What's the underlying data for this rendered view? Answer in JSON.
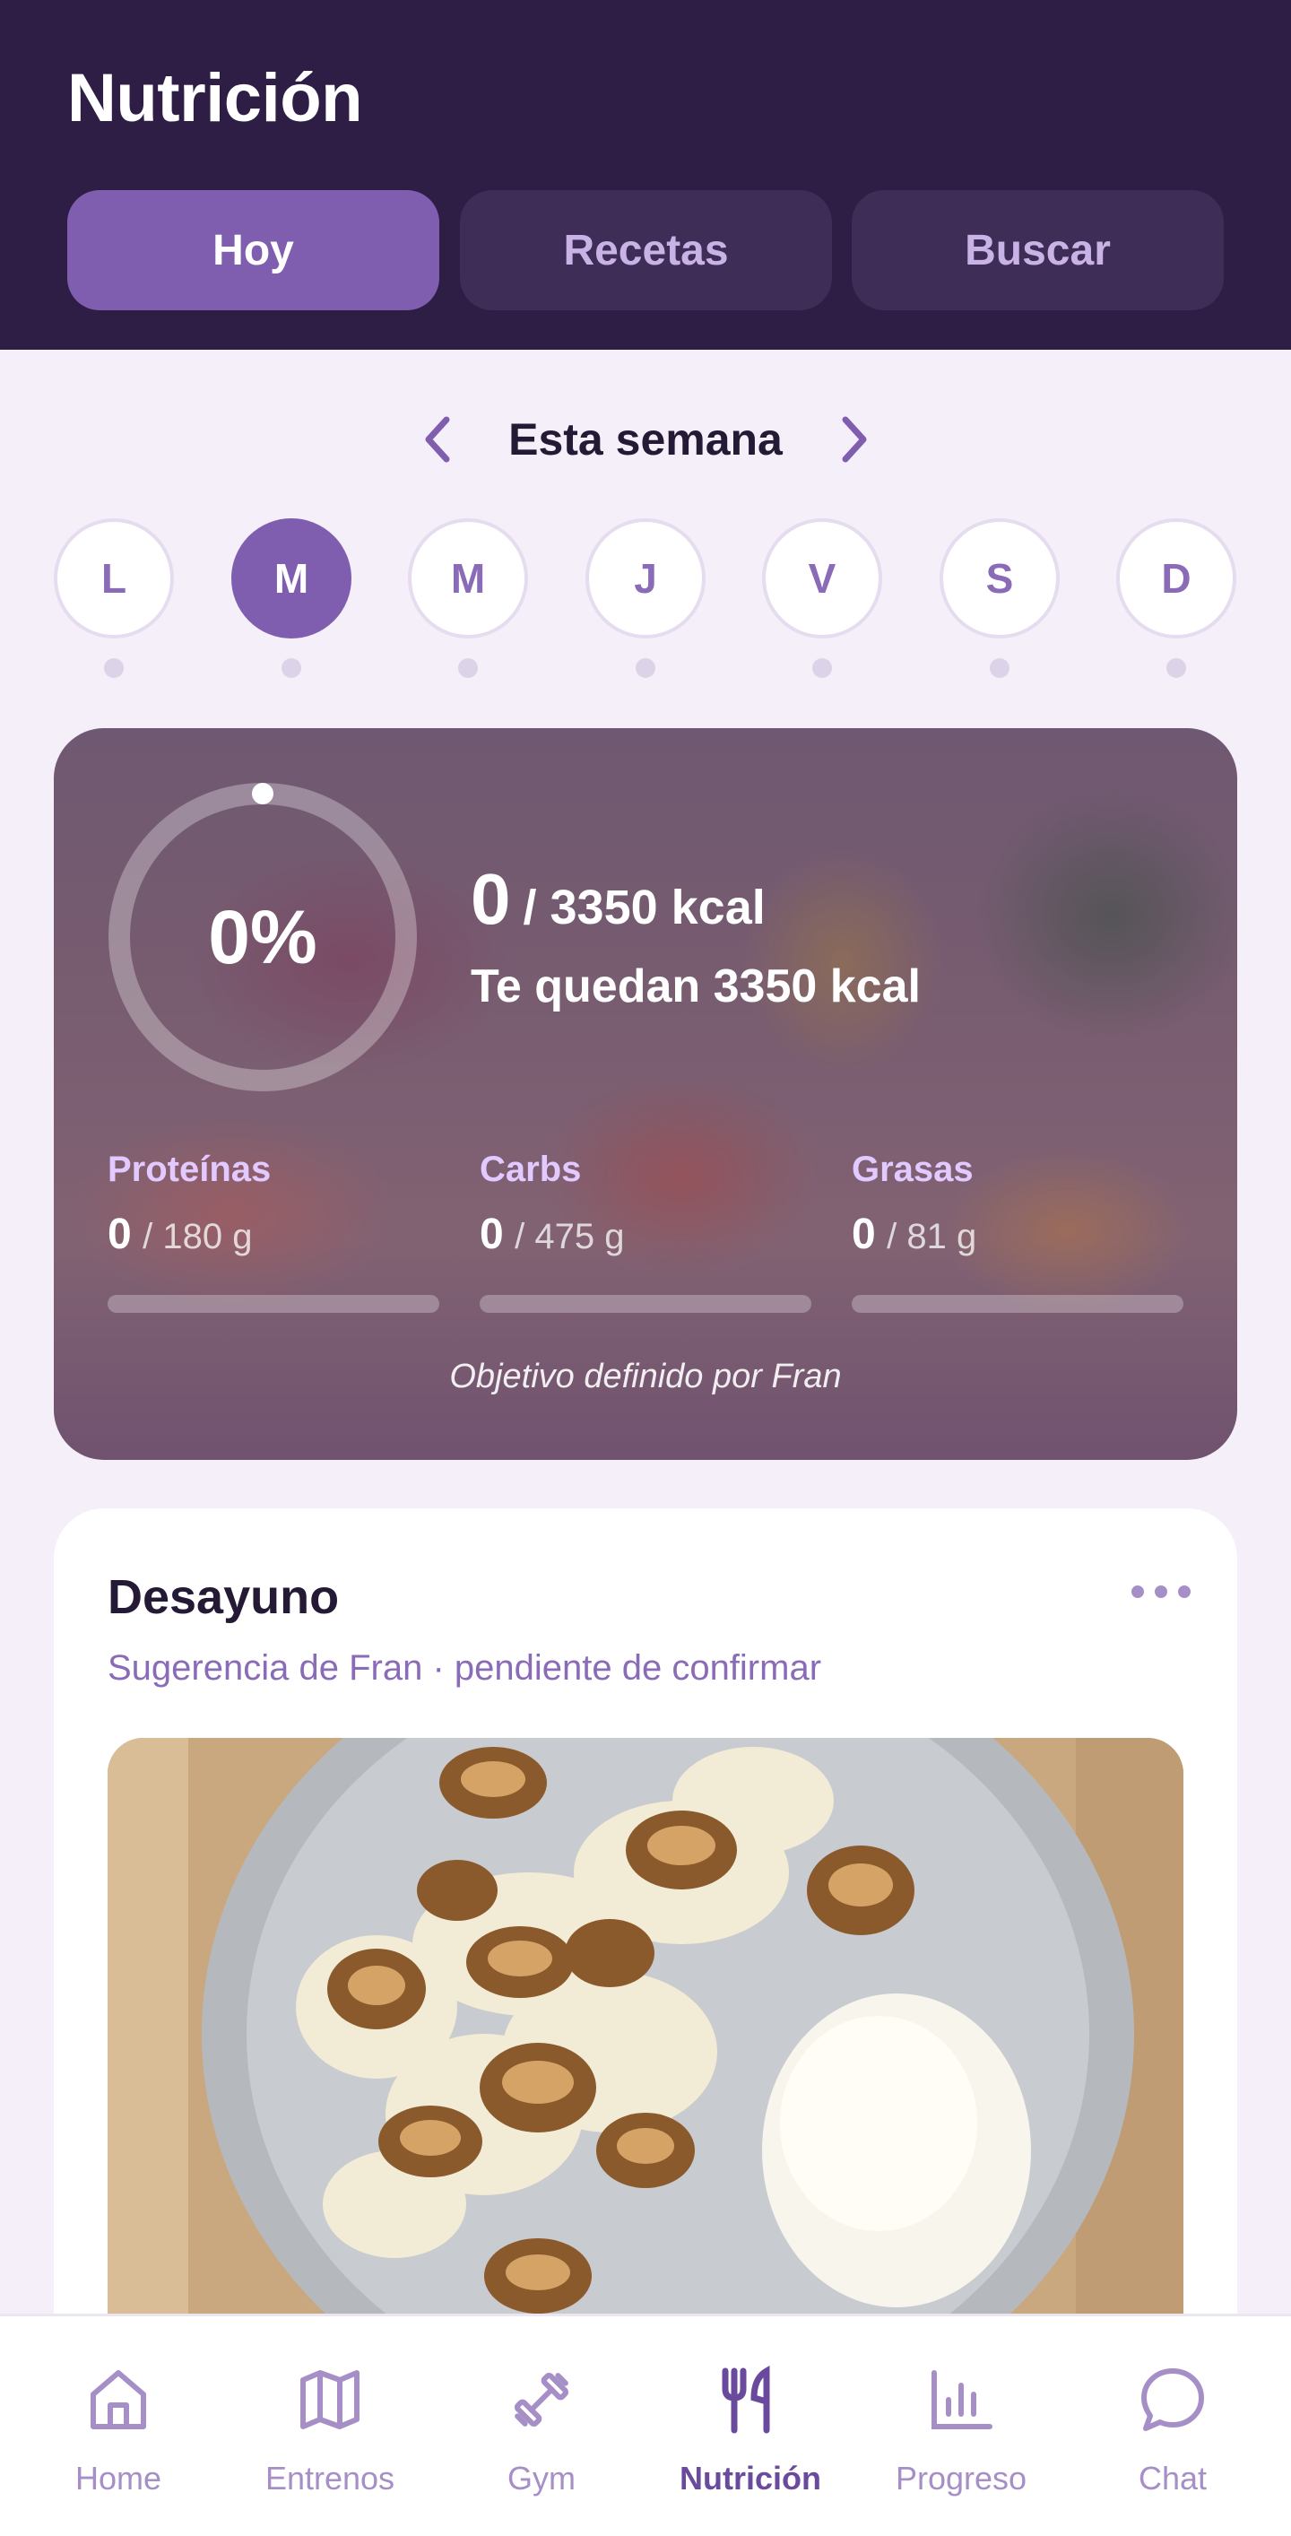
{
  "header": {
    "title": "Nutrición",
    "tabs": [
      {
        "label": "Hoy",
        "active": true
      },
      {
        "label": "Recetas",
        "active": false
      },
      {
        "label": "Buscar",
        "active": false
      }
    ]
  },
  "week": {
    "label": "Esta semana",
    "days": [
      {
        "letter": "L",
        "active": false
      },
      {
        "letter": "M",
        "active": true
      },
      {
        "letter": "M",
        "active": false
      },
      {
        "letter": "J",
        "active": false
      },
      {
        "letter": "V",
        "active": false
      },
      {
        "letter": "S",
        "active": false
      },
      {
        "letter": "D",
        "active": false
      }
    ]
  },
  "summary": {
    "percent_label": "0%",
    "progress_fraction": 0,
    "current_kcal": "0",
    "goal_kcal": "/ 3350 kcal",
    "remaining": "Te quedan 3350 kcal",
    "macros": [
      {
        "label": "Proteínas",
        "current": "0",
        "goal": "/ 180 g",
        "progress_fraction": 0
      },
      {
        "label": "Carbs",
        "current": "0",
        "goal": "/ 475 g",
        "progress_fraction": 0
      },
      {
        "label": "Grasas",
        "current": "0",
        "goal": "/ 81 g",
        "progress_fraction": 0
      }
    ],
    "note": "Objetivo definido por Fran"
  },
  "meal": {
    "title": "Desayuno",
    "subtitle": "Sugerencia de Fran · pendiente de confirmar"
  },
  "bottom_nav": [
    {
      "label": "Home",
      "icon": "home-icon",
      "active": false
    },
    {
      "label": "Entrenos",
      "icon": "map-icon",
      "active": false
    },
    {
      "label": "Gym",
      "icon": "dumbbell-icon",
      "active": false
    },
    {
      "label": "Nutrición",
      "icon": "utensils-icon",
      "active": true
    },
    {
      "label": "Progreso",
      "icon": "bar-chart-icon",
      "active": false
    },
    {
      "label": "Chat",
      "icon": "chat-bubble-icon",
      "active": false
    }
  ],
  "colors": {
    "header_bg": "#2e1d45",
    "accent": "#7f5eb0",
    "page_bg": "#f4eff8"
  }
}
